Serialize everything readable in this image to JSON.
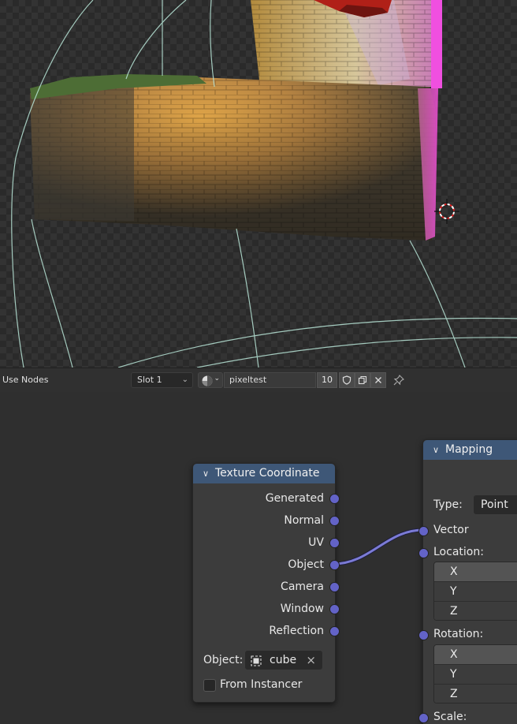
{
  "header": {
    "use_nodes_label": "Use Nodes",
    "slot": "Slot 1",
    "material_name": "pixeltest",
    "user_count": "10",
    "icons": [
      "material-sphere-icon",
      "fake-user-shield-icon",
      "duplicate-icon",
      "close-icon",
      "pin-icon"
    ]
  },
  "texture_coordinate_node": {
    "title": "Texture Coordinate",
    "outputs": [
      "Generated",
      "Normal",
      "UV",
      "Object",
      "Camera",
      "Window",
      "Reflection"
    ],
    "object_label": "Object:",
    "object_value": "cube",
    "from_instancer_label": "From Instancer",
    "from_instancer_checked": false
  },
  "mapping_node": {
    "title": "Mapping",
    "type_label": "Type:",
    "type_value": "Point",
    "inputs": {
      "vector": "Vector",
      "location": "Location:",
      "rotation": "Rotation:",
      "scale": "Scale:"
    },
    "location_axes": [
      "X",
      "Y",
      "Z"
    ],
    "rotation_axes": [
      "X",
      "Y",
      "Z"
    ]
  },
  "colors": {
    "node_header": "#3e5777",
    "socket_vector": "#6363c7",
    "link": "#7b7bd6",
    "editor_background": "#2f2f2f"
  }
}
